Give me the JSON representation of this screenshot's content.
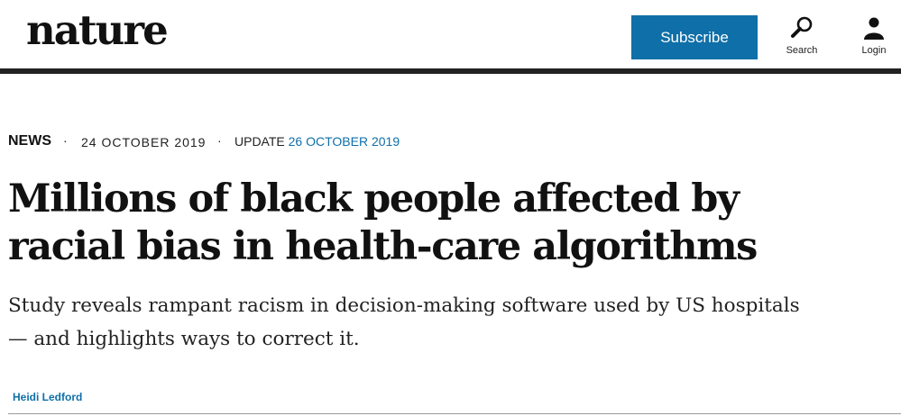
{
  "header": {
    "logo_text": "nature",
    "subscribe_label": "Subscribe",
    "search_label": "Search",
    "login_label": "Login"
  },
  "article": {
    "type": "NEWS",
    "separator": "·",
    "date": "24 OCTOBER 2019",
    "update_prefix": "UPDATE",
    "update_date": "26 OCTOBER 2019",
    "title": "Millions of black people affected by racial bias in health-care algorithms",
    "standfirst": "Study reveals rampant racism in decision-making software used by US hospitals — and highlights ways to correct it.",
    "author": "Heidi Ledford"
  },
  "colors": {
    "accent": "#0f6fa8",
    "header_rule": "#222222"
  }
}
